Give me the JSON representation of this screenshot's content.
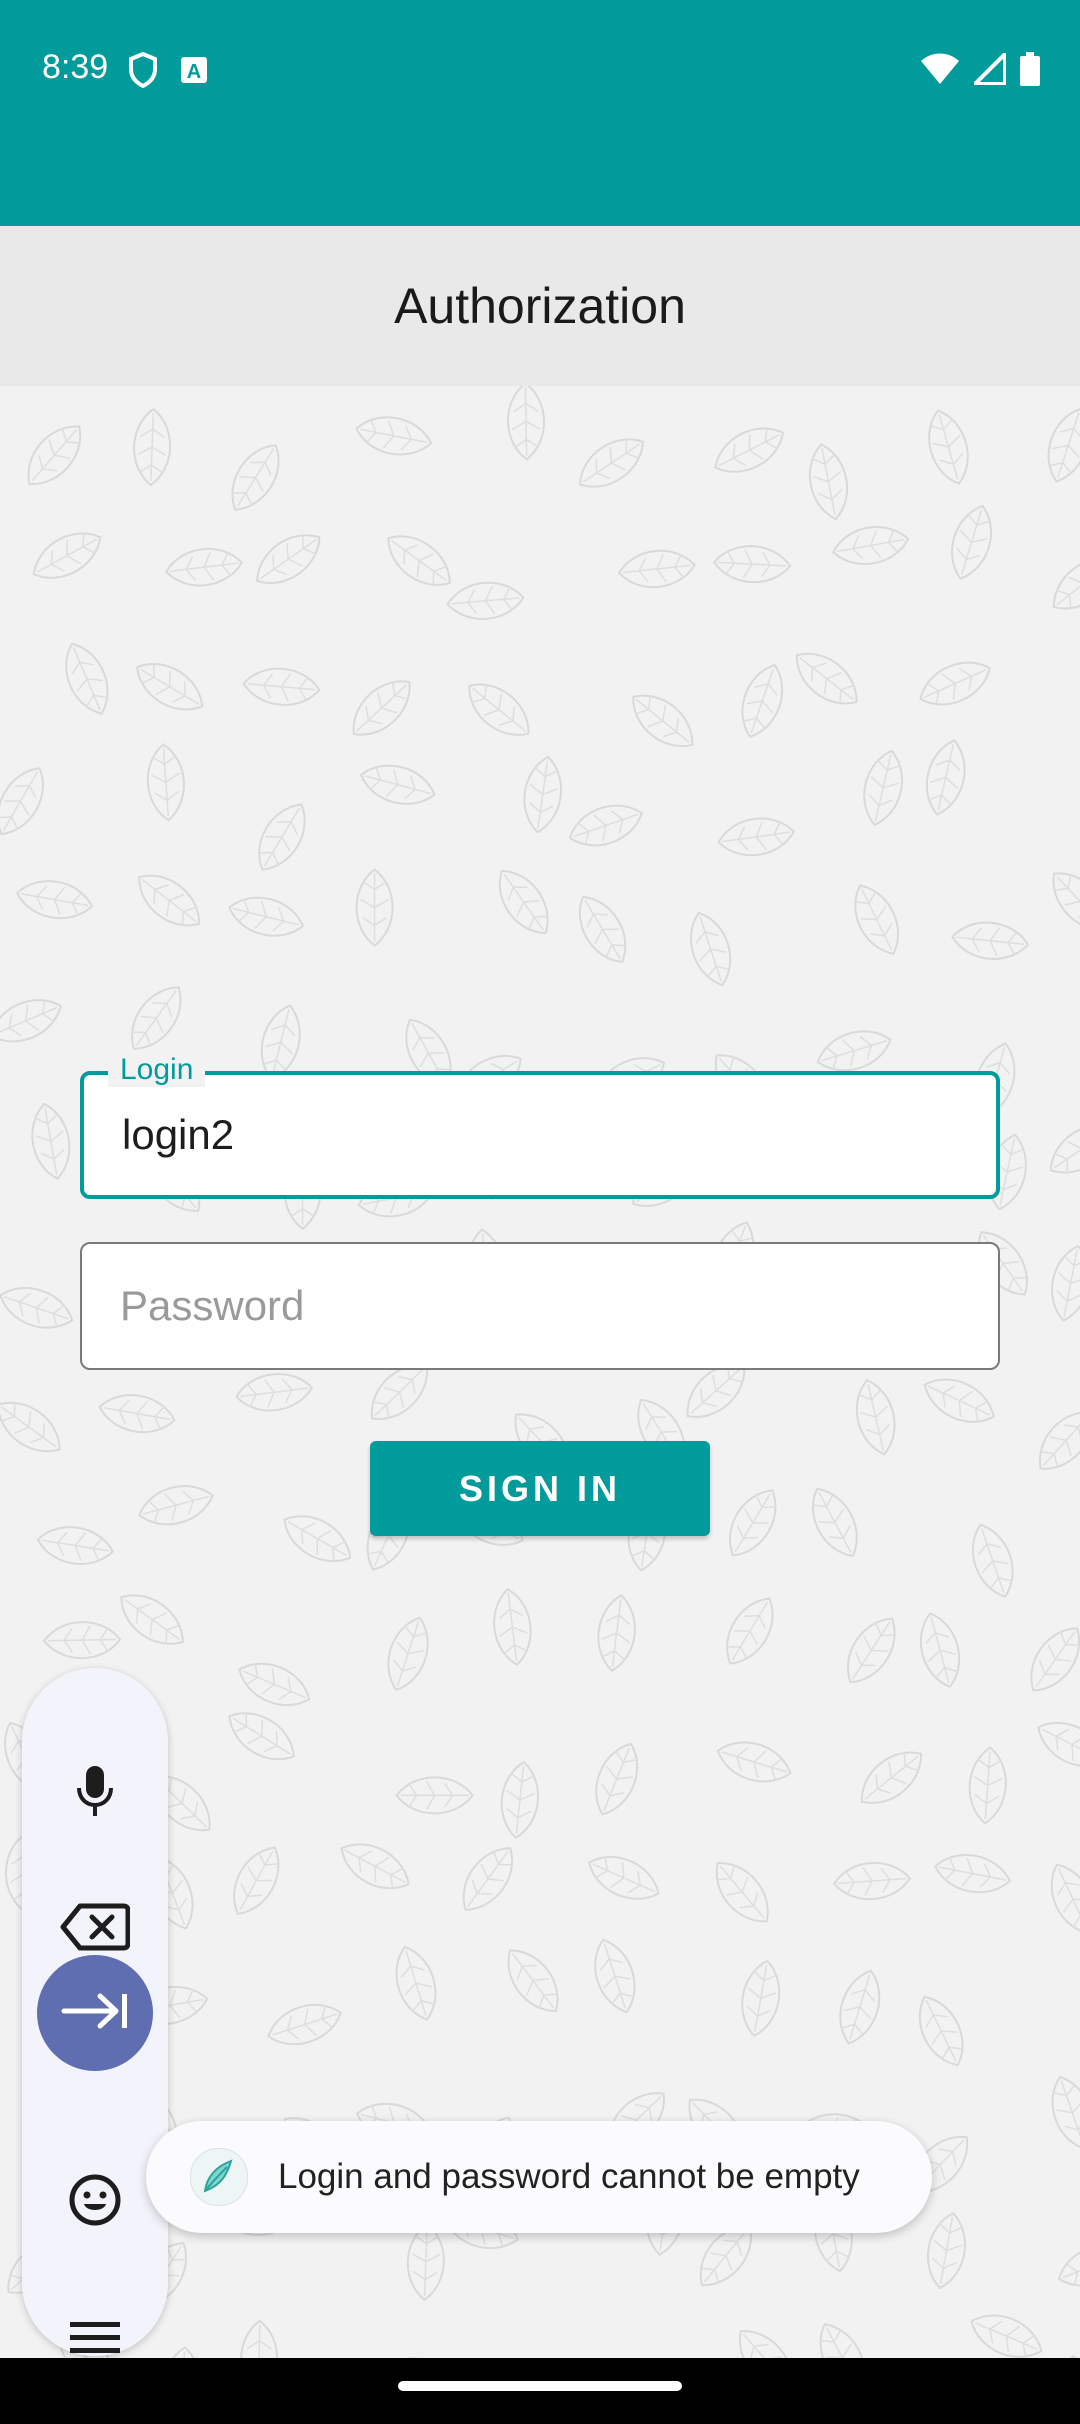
{
  "status_bar": {
    "time": "8:39",
    "left_icons": [
      "shield-icon",
      "text-a-icon"
    ],
    "right_icons": [
      "wifi-icon",
      "signal-icon",
      "battery-icon"
    ],
    "color": "#009b9a"
  },
  "app_bar": {
    "title": "Authorization"
  },
  "form": {
    "login": {
      "label": "Login",
      "value": "login2"
    },
    "password": {
      "placeholder": "Password",
      "value": ""
    },
    "sign_in_label": "SIGN IN"
  },
  "keyboard_bar": {
    "buttons": [
      "microphone-icon",
      "backspace-icon",
      "tab-next-icon",
      "emoji-icon",
      "menu-icon"
    ]
  },
  "toast": {
    "message": "Login and password cannot be empty"
  },
  "colors": {
    "accent": "#009b9a",
    "keyboard_active": "#5e6eb0"
  }
}
